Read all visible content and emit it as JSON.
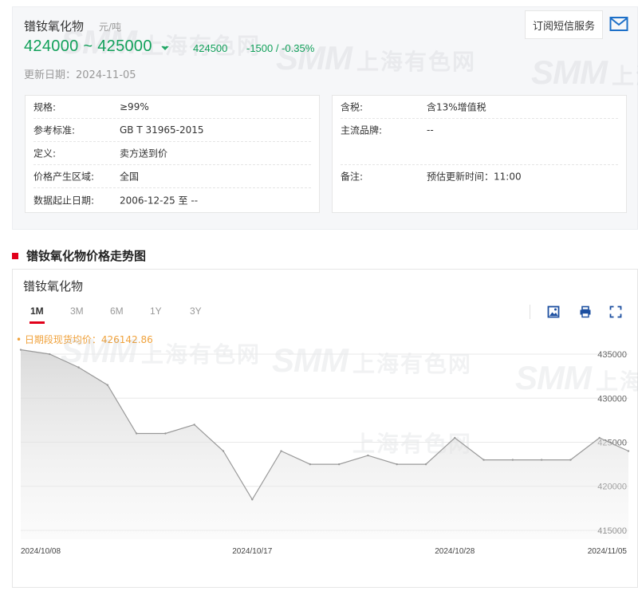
{
  "product": {
    "name": "镨钕氧化物",
    "unit": "元/吨",
    "price_range": "424000 ~ 425000",
    "avg_price": "424500",
    "change": "-1500 / -0.35%",
    "update_date": "更新日期：2024-11-05",
    "trend_icon": "down-arrow-icon"
  },
  "subscribe": {
    "label": "订阅短信服务",
    "icon": "mail-icon"
  },
  "watermark": {
    "brand": "SMM",
    "text": "上海有色网"
  },
  "specs_left": [
    {
      "label": "规格:",
      "value": "≥99%"
    },
    {
      "label": "参考标准:",
      "value": "GB T 31965-2015"
    },
    {
      "label": "定义:",
      "value": "卖方送到价"
    },
    {
      "label": "价格产生区域:",
      "value": "全国"
    },
    {
      "label": "数据起止日期:",
      "value": "2006-12-25 至 --"
    }
  ],
  "specs_right": [
    {
      "label": "含税:",
      "value": "含13%增值税"
    },
    {
      "label": "主流品牌:",
      "value": "--"
    },
    {
      "label": "备注:",
      "value": "预估更新时间：11:00"
    }
  ],
  "section": {
    "title": "镨钕氧化物价格走势图"
  },
  "chart_card": {
    "title": "镨钕氧化物",
    "tabs": [
      "1M",
      "3M",
      "6M",
      "1Y",
      "3Y"
    ],
    "active_tab": "1M",
    "tools": [
      "image-download-icon",
      "print-icon",
      "fullscreen-icon"
    ],
    "avg_label": "• 日期段现货均价：426142.86"
  },
  "colors": {
    "accent": "#e1001a",
    "down": "#11a05a",
    "avg": "#f0a23c",
    "line": "#999999"
  },
  "chart_data": {
    "type": "area",
    "x": [
      "2024/10/08",
      "2024/10/09",
      "2024/10/10",
      "2024/10/11",
      "2024/10/12",
      "2024/10/14",
      "2024/10/15",
      "2024/10/16",
      "2024/10/17",
      "2024/10/18",
      "2024/10/21",
      "2024/10/22",
      "2024/10/23",
      "2024/10/24",
      "2024/10/25",
      "2024/10/28",
      "2024/10/29",
      "2024/10/30",
      "2024/10/31",
      "2024/11/01",
      "2024/11/04",
      "2024/11/05"
    ],
    "values": [
      435500,
      435000,
      433500,
      431500,
      426000,
      426000,
      427000,
      424000,
      418500,
      424000,
      422500,
      422500,
      423500,
      422500,
      422500,
      425500,
      423000,
      423000,
      423000,
      423000,
      425500,
      424000
    ],
    "x_tick_labels": [
      "2024/10/08",
      "2024/10/17",
      "2024/10/28",
      "2024/11/05"
    ],
    "y_ticks": [
      415000,
      420000,
      425000,
      430000,
      435000
    ],
    "ylim": [
      414000,
      436000
    ],
    "grid": true,
    "y_axis_position": "right"
  }
}
